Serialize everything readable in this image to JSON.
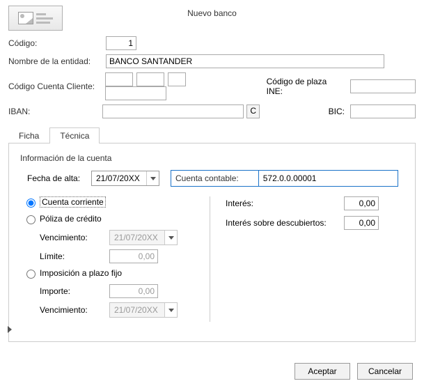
{
  "title": "Nuevo banco",
  "labels": {
    "codigo": "Código:",
    "entidad": "Nombre de la entidad:",
    "ccc": "Código Cuenta Cliente:",
    "ine": "Código de plaza INE:",
    "iban": "IBAN:",
    "c_btn": "C",
    "bic": "BIC:"
  },
  "fields": {
    "codigo": "1",
    "entidad": "BANCO SANTANDER",
    "ccc1": "",
    "ccc2": "",
    "ccc3": "",
    "ccc4": "",
    "ine": "",
    "iban": "",
    "bic": ""
  },
  "tabs": {
    "ficha": "Ficha",
    "tecnica": "Técnica"
  },
  "section": {
    "title": "Información de la cuenta",
    "fecha_alta_lbl": "Fecha de alta:",
    "fecha_alta": "21/07/20XX",
    "cuenta_lbl": "Cuenta contable:",
    "cuenta": "572.0.0.00001"
  },
  "acct": {
    "cc": "Cuenta corriente",
    "poliza": "Póliza de crédito",
    "venc_lbl": "Vencimiento:",
    "venc1": "21/07/20XX",
    "limite_lbl": "Límite:",
    "limite": "0,00",
    "plazo": "Imposición a plazo fijo",
    "importe_lbl": "Importe:",
    "importe": "0,00",
    "venc2": "21/07/20XX"
  },
  "interes": {
    "lbl": "Interés:",
    "val": "0,00",
    "desc_lbl": "Interés sobre descubiertos:",
    "desc_val": "0,00"
  },
  "footer": {
    "ok": "Aceptar",
    "cancel": "Cancelar"
  }
}
